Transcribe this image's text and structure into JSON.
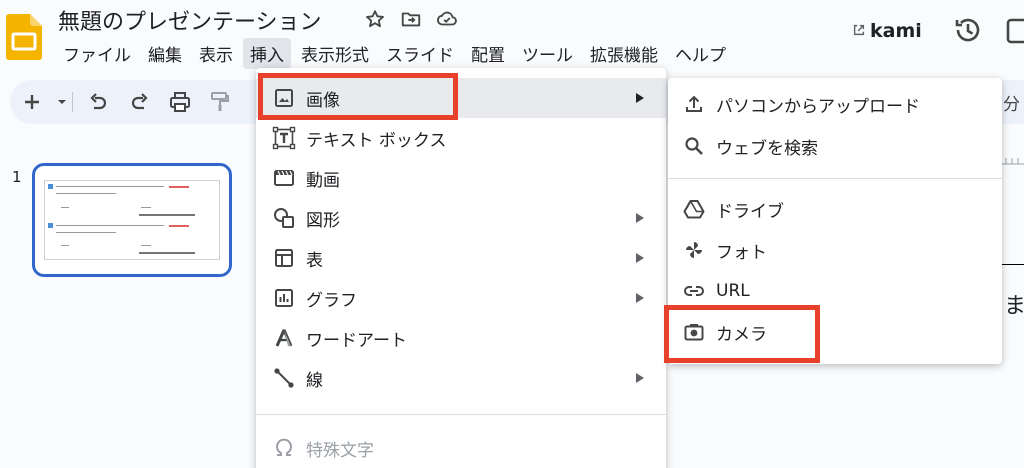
{
  "document": {
    "title": "無題のプレゼンテーション"
  },
  "menubar": {
    "items": [
      "ファイル",
      "編集",
      "表示",
      "挿入",
      "表示形式",
      "スライド",
      "配置",
      "ツール",
      "拡張機能",
      "ヘルプ"
    ],
    "active_index": 3
  },
  "extension": {
    "name": "kami"
  },
  "toolbar": {
    "right_cut_text": "え分"
  },
  "filmstrip": {
    "slide_number": "1"
  },
  "canvas": {
    "visible_char": "ま"
  },
  "insert_menu": {
    "items": [
      {
        "label": "画像",
        "icon": "image-icon",
        "submenu": true,
        "highlighted": true
      },
      {
        "label": "テキスト ボックス",
        "icon": "text-box-icon",
        "submenu": false
      },
      {
        "label": "動画",
        "icon": "video-icon",
        "submenu": false
      },
      {
        "label": "図形",
        "icon": "shapes-icon",
        "submenu": true
      },
      {
        "label": "表",
        "icon": "table-icon",
        "submenu": true
      },
      {
        "label": "グラフ",
        "icon": "chart-icon",
        "submenu": true
      },
      {
        "label": "ワードアート",
        "icon": "word-art-icon",
        "submenu": false
      },
      {
        "label": "線",
        "icon": "line-icon",
        "submenu": true
      },
      {
        "label": "特殊文字",
        "icon": "omega-icon",
        "submenu": false,
        "disabled": true
      }
    ]
  },
  "image_submenu": {
    "items": [
      {
        "label": "パソコンからアップロード",
        "icon": "upload-icon"
      },
      {
        "label": "ウェブを検索",
        "icon": "search-icon"
      },
      {
        "label": "ドライブ",
        "icon": "drive-icon"
      },
      {
        "label": "フォト",
        "icon": "photos-icon"
      },
      {
        "label": "URL",
        "icon": "link-icon"
      },
      {
        "label": "カメラ",
        "icon": "camera-icon",
        "highlighted": true
      }
    ]
  },
  "colors": {
    "highlight_red": "#e8412b",
    "slides_yellow": "#f4b400",
    "selection_blue": "#3366cc",
    "menu_hover": "#e8eaed"
  }
}
